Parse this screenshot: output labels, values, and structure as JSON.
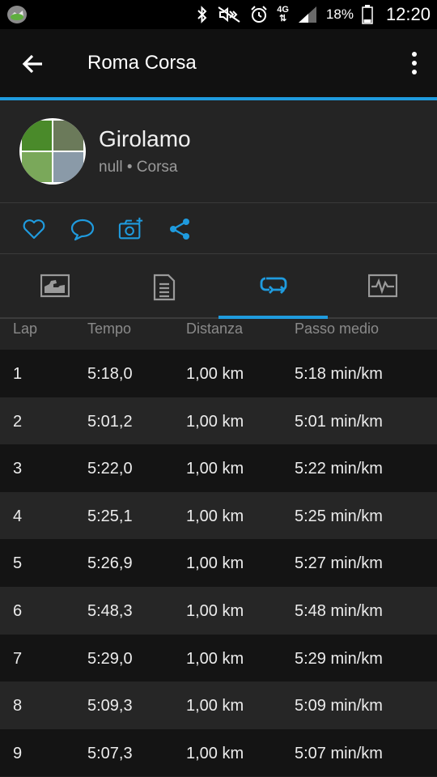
{
  "status_bar": {
    "network": "4G",
    "battery_percent": "18%",
    "time": "12:20"
  },
  "app_bar": {
    "title": "Roma Corsa"
  },
  "profile": {
    "name": "Girolamo",
    "subtitle": "null • Corsa"
  },
  "colors": {
    "accent": "#1f9bde",
    "background": "#1f1f1f"
  },
  "actions": [
    "heart-icon",
    "comment-icon",
    "camera-add-icon",
    "share-icon"
  ],
  "tabs": [
    "chart-tab",
    "details-tab",
    "laps-tab",
    "stats-tab"
  ],
  "active_tab": "laps-tab",
  "table": {
    "headers": {
      "lap": "Lap",
      "time": "Tempo",
      "distance": "Distanza",
      "pace": "Passo medio"
    },
    "rows": [
      {
        "lap": "1",
        "time": "5:18,0",
        "distance": "1,00 km",
        "pace": "5:18 min/km"
      },
      {
        "lap": "2",
        "time": "5:01,2",
        "distance": "1,00 km",
        "pace": "5:01 min/km"
      },
      {
        "lap": "3",
        "time": "5:22,0",
        "distance": "1,00 km",
        "pace": "5:22 min/km"
      },
      {
        "lap": "4",
        "time": "5:25,1",
        "distance": "1,00 km",
        "pace": "5:25 min/km"
      },
      {
        "lap": "5",
        "time": "5:26,9",
        "distance": "1,00 km",
        "pace": "5:27 min/km"
      },
      {
        "lap": "6",
        "time": "5:48,3",
        "distance": "1,00 km",
        "pace": "5:48 min/km"
      },
      {
        "lap": "7",
        "time": "5:29,0",
        "distance": "1,00 km",
        "pace": "5:29 min/km"
      },
      {
        "lap": "8",
        "time": "5:09,3",
        "distance": "1,00 km",
        "pace": "5:09 min/km"
      },
      {
        "lap": "9",
        "time": "5:07,3",
        "distance": "1,00 km",
        "pace": "5:07 min/km"
      }
    ]
  }
}
